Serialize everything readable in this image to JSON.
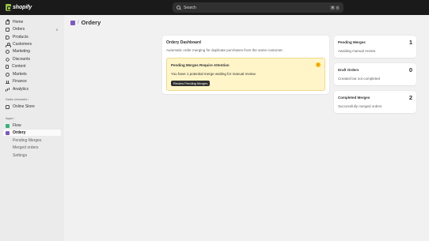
{
  "topbar": {
    "logo_text": "shopify",
    "search_placeholder": "Search",
    "shortcut_keys": [
      "⌘",
      "K"
    ]
  },
  "sidebar": {
    "items": [
      {
        "label": "Home",
        "icon": "home-icon"
      },
      {
        "label": "Orders",
        "icon": "orders-icon",
        "badge": "0"
      },
      {
        "label": "Products",
        "icon": "products-icon"
      },
      {
        "label": "Customers",
        "icon": "customers-icon"
      },
      {
        "label": "Marketing",
        "icon": "marketing-icon"
      },
      {
        "label": "Discounts",
        "icon": "discounts-icon"
      },
      {
        "label": "Content",
        "icon": "content-icon"
      },
      {
        "label": "Markets",
        "icon": "markets-icon"
      },
      {
        "label": "Finance",
        "icon": "finance-icon"
      },
      {
        "label": "Analytics",
        "icon": "analytics-icon"
      }
    ],
    "sales_channels_label": "Sales channels",
    "online_store_label": "Online Store",
    "apps_label": "Apps",
    "flow_label": "Flow",
    "ordery_label": "Ordery",
    "ordery_subitems": [
      "Pending Merges",
      "Merged orders",
      "Settings"
    ]
  },
  "page": {
    "title": "Ordery"
  },
  "dashboard": {
    "title": "Ordery Dashboard",
    "subtitle": "Automatic order merging for duplicate purchases from the same customer.",
    "alert": {
      "title": "Pending Merges Require Attention",
      "icon_text": "!",
      "body": "You have 1 potential merge waiting for manual review.",
      "button": "Review Pending Merges"
    }
  },
  "stats": [
    {
      "title": "Pending Merges",
      "value": "1",
      "subtitle": "Awaiting manual review"
    },
    {
      "title": "Draft Orders",
      "value": "0",
      "subtitle": "Created but not completed"
    },
    {
      "title": "Completed Merges",
      "value": "2",
      "subtitle": "Successfully merged orders"
    }
  ],
  "colors": {
    "topbar": "#1a1a1a",
    "sidebar": "#ebebeb",
    "background": "#f1f1f1",
    "alert_bg": "#fff5c9",
    "alert_icon": "#ffb800",
    "ordery_app": "#7e57c2",
    "flow_app": "#36b37e",
    "logo": "#95bf47"
  }
}
